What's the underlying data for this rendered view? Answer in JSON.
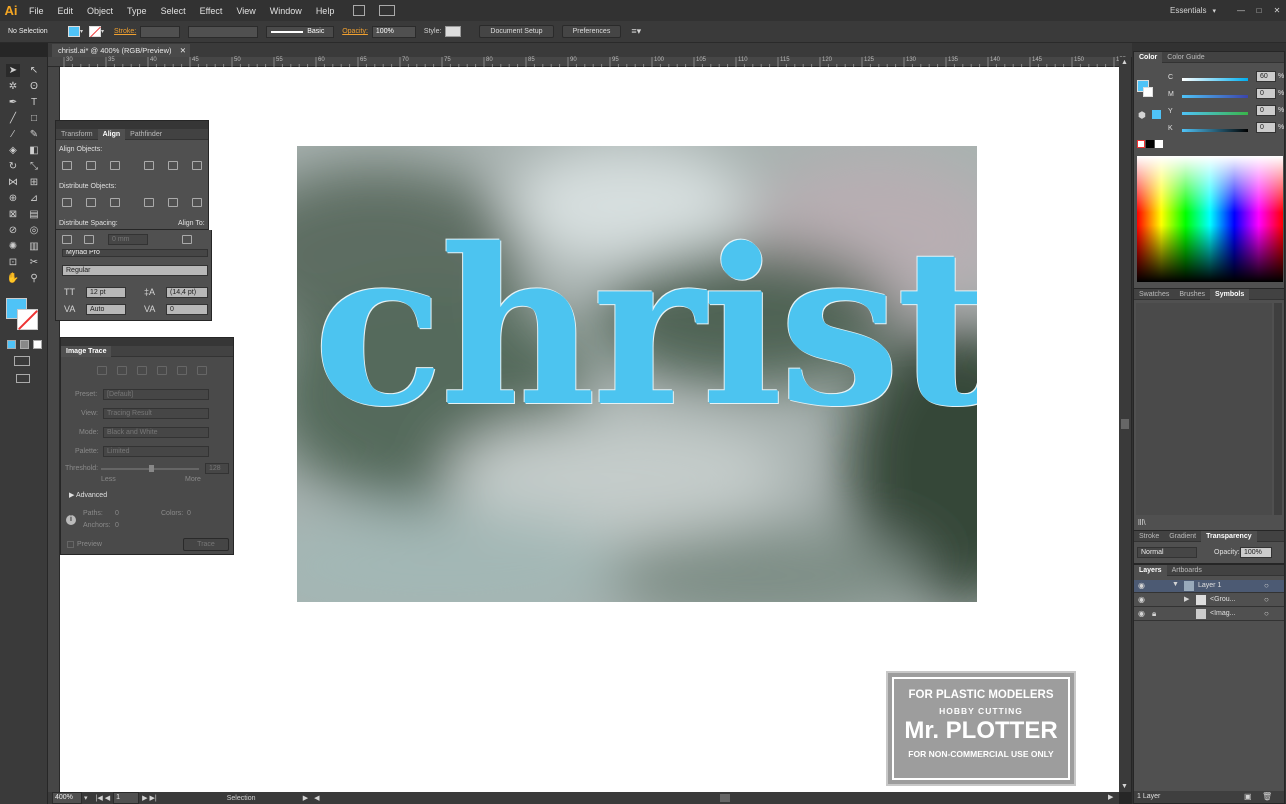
{
  "app": {
    "logo": "Ai"
  },
  "menu": [
    "File",
    "Edit",
    "Object",
    "Type",
    "Select",
    "Effect",
    "View",
    "Window",
    "Help"
  ],
  "workspace": "Essentials",
  "control_bar": {
    "selection": "No Selection",
    "fill_color": "#4fc3f7",
    "stroke_label": "Stroke:",
    "brush_label": "Basic",
    "opacity_label": "Opacity:",
    "opacity_value": "100%",
    "style_label": "Style:",
    "document_setup": "Document Setup",
    "preferences": "Preferences"
  },
  "document": {
    "tab_title": "christl.ai* @ 400% (RGB/Preview)"
  },
  "ruler": {
    "h_ticks": [
      "30",
      "35",
      "40",
      "45",
      "50",
      "55",
      "60",
      "65",
      "70",
      "75",
      "80",
      "85",
      "90",
      "95",
      "100",
      "105",
      "110",
      "115",
      "120",
      "125",
      "130",
      "135",
      "140",
      "145",
      "150",
      "155",
      "160",
      "165"
    ]
  },
  "canvas": {
    "artwork_text": "christl",
    "letter_color": "#4cc4f0"
  },
  "align_panel": {
    "tabs": [
      "Transform",
      "Align",
      "Pathfinder"
    ],
    "align_objects": "Align Objects:",
    "distribute_objects": "Distribute Objects:",
    "distribute_spacing": "Distribute Spacing:",
    "align_to": "Align To:",
    "spacing_value": "0 mm"
  },
  "character_panel": {
    "font": "Myriad Pro",
    "style": "Regular",
    "size": "12 pt",
    "leading": "(14,4 pt)",
    "kerning": "Auto",
    "tracking": "0"
  },
  "image_trace": {
    "title": "Image Trace",
    "preset_label": "Preset:",
    "preset_value": "[Default]",
    "view_label": "View:",
    "view_value": "Tracing Result",
    "mode_label": "Mode:",
    "mode_value": "Black and White",
    "palette_label": "Palette:",
    "palette_value": "Limited",
    "threshold_label": "Threshold:",
    "threshold_value": "128",
    "less": "Less",
    "more": "More",
    "advanced": "Advanced",
    "paths_label": "Paths:",
    "paths_value": "0",
    "colors_label": "Colors:",
    "colors_value": "0",
    "anchors_label": "Anchors:",
    "anchors_value": "0",
    "preview": "Preview",
    "trace": "Trace"
  },
  "color_panel": {
    "tabs": [
      "Color",
      "Color Guide"
    ],
    "channels": [
      {
        "label": "C",
        "value": "60"
      },
      {
        "label": "M",
        "value": "0"
      },
      {
        "label": "Y",
        "value": "0"
      },
      {
        "label": "K",
        "value": "0"
      }
    ],
    "percent": "%"
  },
  "swatches_panel": {
    "tabs": [
      "Swatches",
      "Brushes",
      "Symbols"
    ]
  },
  "transparency_panel": {
    "tabs": [
      "Stroke",
      "Gradient",
      "Transparency"
    ],
    "blend_mode": "Normal",
    "opacity_label": "Opacity:",
    "opacity_value": "100%"
  },
  "layers_panel": {
    "tabs": [
      "Layers",
      "Artboards"
    ],
    "rows": [
      {
        "name": "Layer 1"
      },
      {
        "name": "<Grou..."
      },
      {
        "name": "<Imag..."
      }
    ],
    "footer": "1 Layer"
  },
  "status": {
    "zoom": "400%",
    "artboard": "1",
    "tool": "Selection"
  },
  "watermark": {
    "line1": "FOR PLASTIC MODELERS",
    "line2": "HOBBY CUTTING",
    "line3": "Mr. PLOTTER",
    "line4": "FOR NON-COMMERCIAL USE ONLY"
  }
}
